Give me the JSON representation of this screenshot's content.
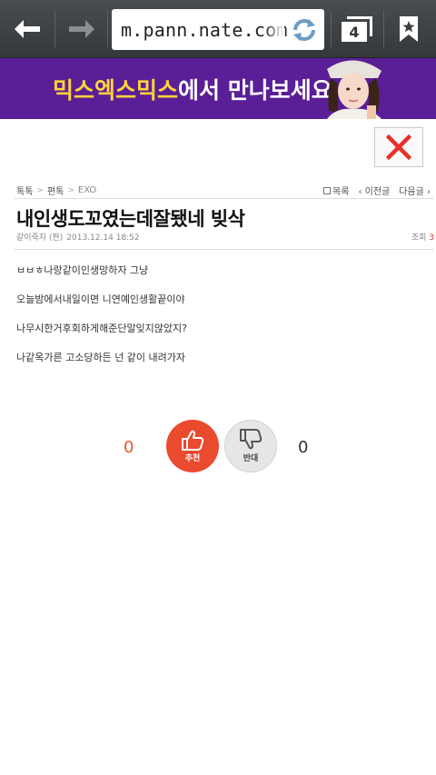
{
  "browser": {
    "url": "m.pann.nate.com/co",
    "tab_count": "4",
    "icons": {
      "back": "back-arrow-icon",
      "forward": "forward-arrow-icon",
      "reload": "reload-icon",
      "tabs": "tabs-icon",
      "bookmark": "bookmark-icon"
    }
  },
  "ad": {
    "highlight": "믹스엑스믹스",
    "rest": "에서 만나보세요",
    "colors": {
      "background": "#5a1e96",
      "highlight": "#ffd33a"
    }
  },
  "close_icon": "close-x-icon",
  "breadcrumb": {
    "items": [
      "톡톡",
      "편톡",
      "EXO"
    ],
    "separator": ">"
  },
  "post_nav": {
    "list": "목록",
    "prev": "‹ 이전글",
    "next": "다음글 ›"
  },
  "post": {
    "title": "내인생도꼬였는데잘됐네 빚삭",
    "author": "같이죽자 (판)",
    "date": "2013.12.14 18:52",
    "views_label": "조회",
    "views_count": "3",
    "body": [
      "ㅂㅂㅎ나랑같이인생망하자 그냥",
      "오늘밤에서내일이면 니연예인생활끝이야",
      "나무시한거후회하게해준단말잊지않았지?",
      "나같옥가른 고소당하든 넌 같이 내려가자"
    ]
  },
  "votes": {
    "up_count": "0",
    "up_label": "추천",
    "down_count": "0",
    "down_label": "반대",
    "colors": {
      "up": "#ea4a2e",
      "down": "#e6e6e6"
    }
  }
}
